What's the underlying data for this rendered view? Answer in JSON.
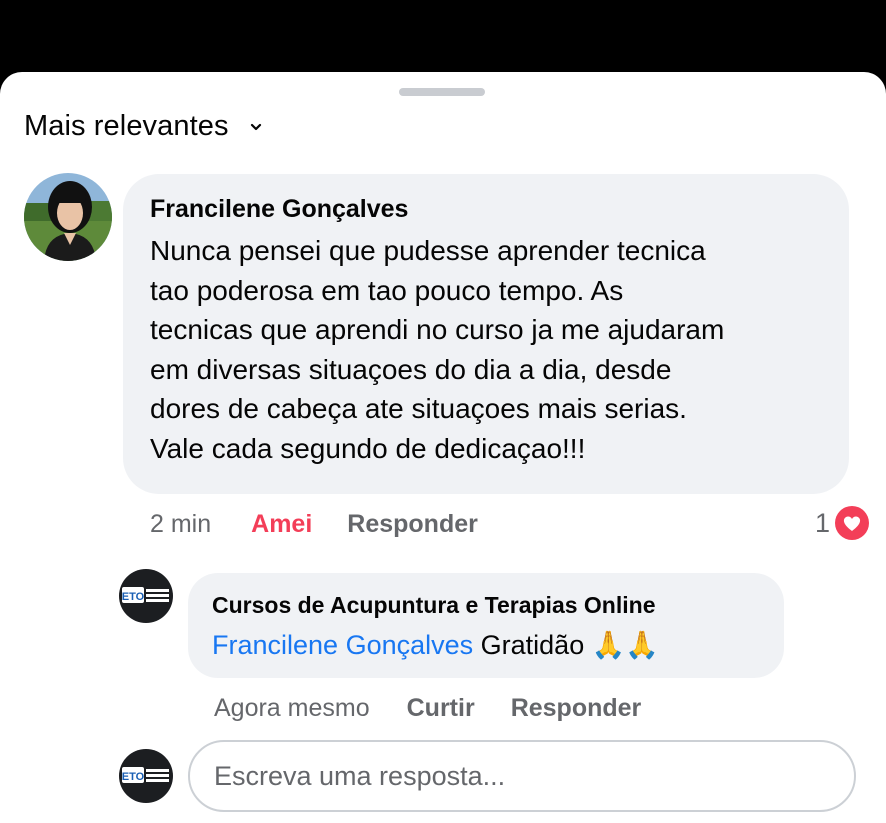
{
  "sort": {
    "label": "Mais relevantes"
  },
  "comment": {
    "author": "Francilene Gonçalves",
    "lines": [
      "Nunca pensei que pudesse aprender tecnica",
      "tao poderosa em tao pouco tempo. As",
      "tecnicas que aprendi no curso ja me ajudaram",
      "em diversas situaçoes do dia a dia, desde",
      "dores de cabeça ate situaçoes mais serias.",
      "Vale cada segundo de dedicaçao!!!"
    ],
    "time": "2 min",
    "reaction_label": "Amei",
    "reply_label": "Responder",
    "reaction_count": "1",
    "reaction_icon": "heart-icon",
    "reaction_color": "#f33e58"
  },
  "reply": {
    "author": "Cursos de Acupuntura e Terapias Online",
    "mention": "Francilene Gonçalves",
    "text": "Gratidão",
    "emoji": "🙏🙏",
    "time": "Agora mesmo",
    "like_label": "Curtir",
    "reply_label": "Responder",
    "logo_text": "ETO"
  },
  "composer": {
    "placeholder": "Escreva uma resposta..."
  },
  "colors": {
    "mention": "#1877f2",
    "love": "#f33e58",
    "muted": "#65676b",
    "bubble": "#f0f2f5"
  }
}
